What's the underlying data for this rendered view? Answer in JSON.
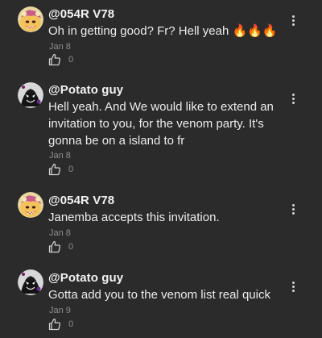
{
  "comments": [
    {
      "username": "@054R V78",
      "text": "Oh in getting good? Fr? Hell yeah 🔥🔥🔥",
      "date": "Jan 8",
      "likes": "0",
      "avatar": "janemba-avatar"
    },
    {
      "username": "@Potato guy",
      "text": "Hell yeah. And We would like to extend an invitation to you, for the venom party. It's gonna be on a island to fr",
      "date": "Jan 8",
      "likes": "0",
      "avatar": "venom-avatar"
    },
    {
      "username": "@054R V78",
      "text": "Janemba accepts this invitation.",
      "date": "Jan 8",
      "likes": "0",
      "avatar": "janemba-avatar"
    },
    {
      "username": "@Potato guy",
      "text": "Gotta add you to the venom list real quick",
      "date": "Jan 9",
      "likes": "0",
      "avatar": "venom-avatar"
    }
  ],
  "icons": {
    "like": "thumbs-up-icon",
    "more": "more-vertical-icon"
  },
  "colors": {
    "background": "#2b2b2b",
    "text": "#ececec",
    "meta": "#8e8e8e"
  }
}
